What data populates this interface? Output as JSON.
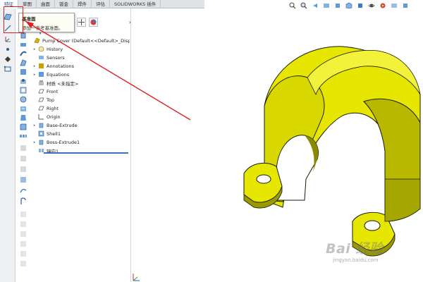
{
  "command_tabs": [
    "特征",
    "草图",
    "曲面",
    "钣金",
    "焊件",
    "评估",
    "SOLIDWORKS 插件"
  ],
  "tooltip": {
    "title": "基准面",
    "description": "添加一参考基准面。"
  },
  "tree": {
    "root": "Pump Cover  (Default<<Default>_Disp",
    "items": [
      {
        "label": "History",
        "icon": "history-icon",
        "expandable": true
      },
      {
        "label": "Sensors",
        "icon": "sensor-icon",
        "expandable": false
      },
      {
        "label": "Annotations",
        "icon": "annotation-icon",
        "expandable": true
      },
      {
        "label": "Equations",
        "icon": "equation-icon",
        "expandable": true
      },
      {
        "label": "材质 <未指定>",
        "icon": "material-icon",
        "expandable": false
      },
      {
        "label": "Front",
        "icon": "plane-icon",
        "expandable": false
      },
      {
        "label": "Top",
        "icon": "plane-icon",
        "expandable": false
      },
      {
        "label": "Right",
        "icon": "plane-icon",
        "expandable": false
      },
      {
        "label": "Origin",
        "icon": "origin-icon",
        "expandable": false
      },
      {
        "label": "Base-Extrude",
        "icon": "extrude-icon",
        "expandable": true
      },
      {
        "label": "Shell1",
        "icon": "shell-icon",
        "expandable": false
      },
      {
        "label": "Boss-Extrude1",
        "icon": "extrude-icon",
        "expandable": true
      },
      {
        "label": "镜向1",
        "icon": "mirror-icon",
        "expandable": false
      }
    ]
  },
  "watermark": {
    "brand": "Bai 经验",
    "url": "jingyan.baidu.com"
  },
  "colors": {
    "part": "#e6e600",
    "part_shade": "#b8b800",
    "part_dark": "#8a8a00",
    "highlight": "#e02020",
    "rollback": "#3b6fc4"
  }
}
